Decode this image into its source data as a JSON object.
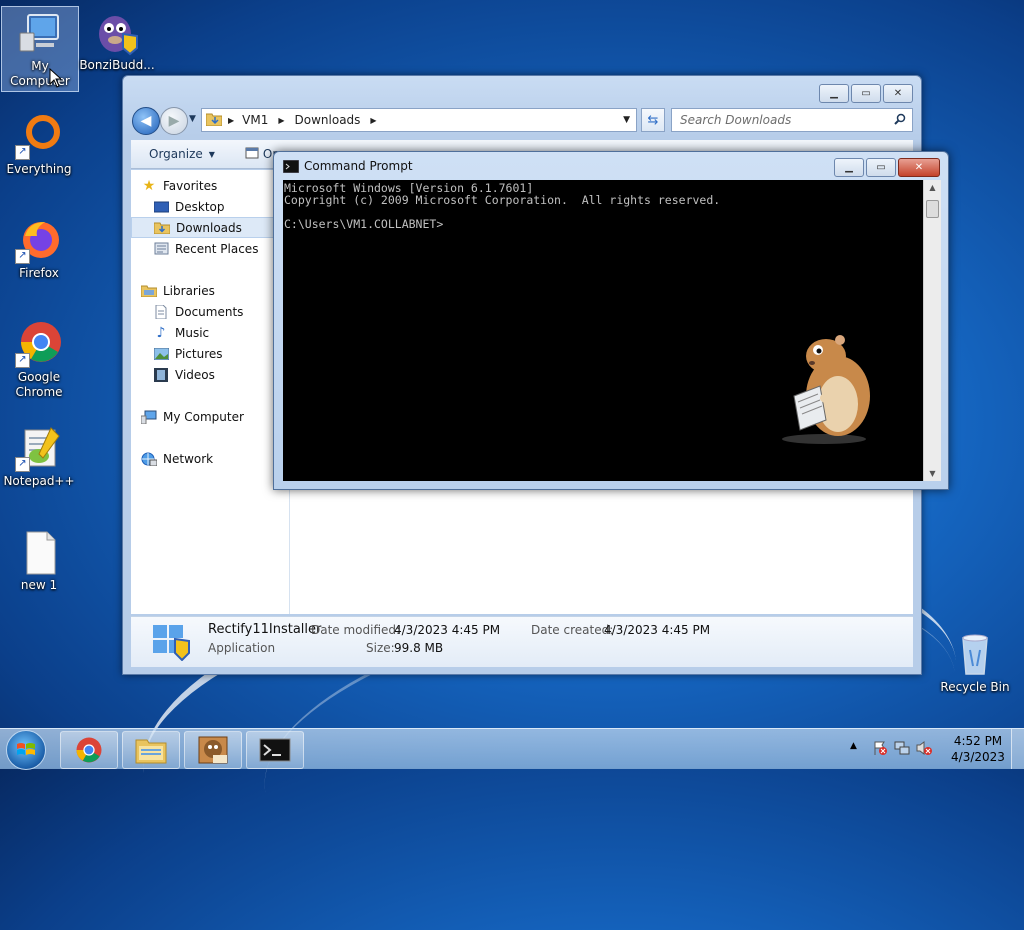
{
  "desktop": {
    "icons": [
      {
        "label": "My Computer",
        "icon": "computer-icon"
      },
      {
        "label": "BonziBudd...",
        "icon": "bonzi-icon"
      },
      {
        "label": "Everything",
        "icon": "everything-icon"
      },
      {
        "label": "Firefox",
        "icon": "firefox-icon"
      },
      {
        "label": "Google Chrome",
        "icon": "chrome-icon"
      },
      {
        "label": "Notepad++",
        "icon": "notepadpp-icon"
      },
      {
        "label": "new 1",
        "icon": "text-file-icon"
      },
      {
        "label": "Recycle Bin",
        "icon": "recycle-bin-icon"
      }
    ]
  },
  "explorer": {
    "breadcrumb": [
      "VM1",
      "Downloads"
    ],
    "search_placeholder": "Search Downloads",
    "toolbar": {
      "organize": "Organize",
      "open": "Op"
    },
    "nav": {
      "favorites": "Favorites",
      "desktop": "Desktop",
      "downloads": "Downloads",
      "recent_places": "Recent Places",
      "libraries": "Libraries",
      "documents": "Documents",
      "music": "Music",
      "pictures": "Pictures",
      "videos": "Videos",
      "my_computer": "My Computer",
      "network": "Network"
    },
    "details": {
      "name": "Rectify11Installer",
      "type": "Application",
      "date_modified_label": "Date modified:",
      "date_modified": "4/3/2023 4:45 PM",
      "date_created_label": "Date created:",
      "date_created": "4/3/2023 4:45 PM",
      "size_label": "Size:",
      "size": "99.8 MB"
    }
  },
  "cmd": {
    "title": "Command Prompt",
    "line1": "Microsoft Windows [Version 6.1.7601]",
    "line2": "Copyright (c) 2009 Microsoft Corporation.  All rights reserved.",
    "prompt": "C:\\Users\\VM1.COLLABNET>"
  },
  "taskbar": {
    "time": "4:52 PM",
    "date": "4/3/2023"
  },
  "colors": {
    "accent": "#1565c0",
    "close": "#c4432b"
  }
}
